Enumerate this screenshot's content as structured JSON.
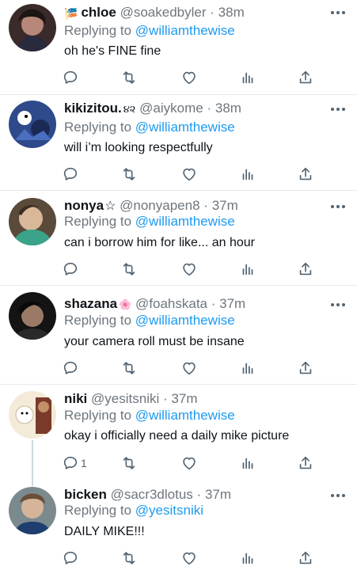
{
  "tweets": [
    {
      "name": "chloe",
      "name_prefix": "🎏",
      "handle": "@soakedbyler",
      "time": "38m",
      "reply_prefix": "Replying to",
      "reply_to": "@williamthewise",
      "text": "oh he's FINE fine",
      "reply_count": ""
    },
    {
      "name": "kikizitou.",
      "badge": "૪૨",
      "handle": "@aiykome",
      "time": "38m",
      "reply_prefix": "Replying to",
      "reply_to": "@williamthewise",
      "text": "will i’m looking respectfully",
      "reply_count": ""
    },
    {
      "name": "nonya",
      "badge": "☆",
      "handle": "@nonyapen8",
      "time": "37m",
      "reply_prefix": "Replying to",
      "reply_to": "@williamthewise",
      "text": "can i borrow him for like... an hour",
      "reply_count": ""
    },
    {
      "name": "shazana",
      "badge": "🌸",
      "handle": "@foahskata",
      "time": "37m",
      "reply_prefix": "Replying to",
      "reply_to": "@williamthewise",
      "text": "your camera roll must be insane",
      "reply_count": ""
    },
    {
      "name": "niki",
      "handle": "@yesitsniki",
      "time": "37m",
      "reply_prefix": "Replying to",
      "reply_to": "@williamthewise",
      "text": "okay i officially need a daily mike picture",
      "reply_count": "1"
    },
    {
      "name": "bicken",
      "handle": "@sacr3dlotus",
      "time": "37m",
      "reply_prefix": "Replying to",
      "reply_to": "@yesitsniki",
      "text": "DAILY MIKE!!!",
      "reply_count": ""
    }
  ],
  "separator": "·",
  "colors": {
    "mention": "#1d9bf0",
    "secondary": "#6e767d",
    "icon": "#536471"
  },
  "icons": [
    "reply-icon",
    "retweet-icon",
    "like-icon",
    "analytics-icon",
    "share-icon",
    "more-icon"
  ]
}
